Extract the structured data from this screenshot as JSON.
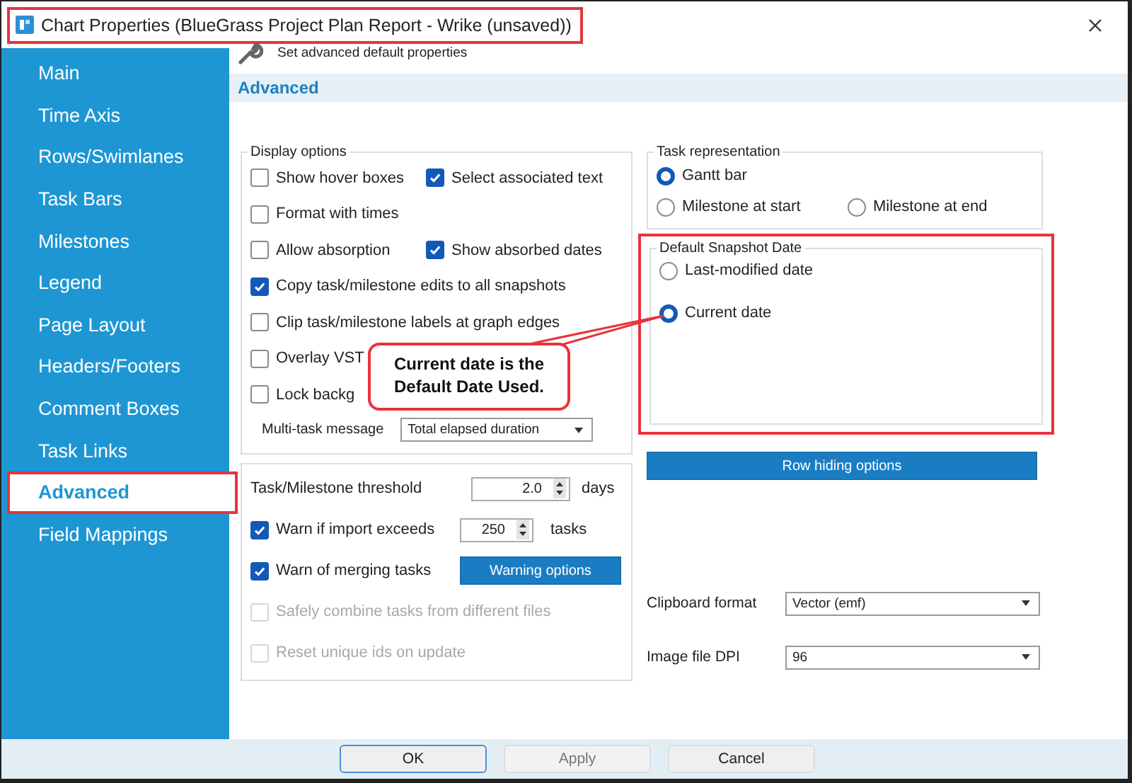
{
  "window": {
    "title": "Chart Properties (BlueGrass Project Plan Report - Wrike (unsaved))",
    "highlighted": true
  },
  "sidebar": {
    "items": [
      {
        "label": "Main",
        "selected": false,
        "highlighted": false
      },
      {
        "label": "Time Axis",
        "selected": false,
        "highlighted": false
      },
      {
        "label": "Rows/Swimlanes",
        "selected": false,
        "highlighted": false
      },
      {
        "label": "Task Bars",
        "selected": false,
        "highlighted": false
      },
      {
        "label": "Milestones",
        "selected": false,
        "highlighted": false
      },
      {
        "label": "Legend",
        "selected": false,
        "highlighted": false
      },
      {
        "label": "Page Layout",
        "selected": false,
        "highlighted": false
      },
      {
        "label": "Headers/Footers",
        "selected": false,
        "highlighted": false
      },
      {
        "label": "Comment Boxes",
        "selected": false,
        "highlighted": false
      },
      {
        "label": "Task Links",
        "selected": false,
        "highlighted": false
      },
      {
        "label": "Advanced",
        "selected": true,
        "highlighted": true
      },
      {
        "label": "Field Mappings",
        "selected": false,
        "highlighted": false
      }
    ]
  },
  "page_header": {
    "description": "Set advanced default properties",
    "section": "Advanced"
  },
  "display_options": {
    "title": "Display options",
    "rows": [
      [
        {
          "label": "Show hover boxes",
          "checked": false
        },
        {
          "label": "Select associated text",
          "checked": true
        }
      ],
      [
        {
          "label": "Format with times",
          "checked": false
        }
      ],
      [
        {
          "label": "Allow absorption",
          "checked": false
        },
        {
          "label": "Show absorbed dates",
          "checked": true
        }
      ],
      [
        {
          "label": "Copy task/milestone edits to all snapshots",
          "checked": true
        }
      ],
      [
        {
          "label": "Clip task/milestone labels at graph edges",
          "checked": false
        }
      ],
      [
        {
          "label": "Overlay VST",
          "checked": false
        }
      ],
      [
        {
          "label": "Lock backg",
          "checked": false
        }
      ]
    ],
    "multi_task": {
      "label": "Multi-task message",
      "value": "Total elapsed duration"
    }
  },
  "thresholds": {
    "items": [
      {
        "kind": "spin",
        "label": "Task/Milestone threshold",
        "value": "2.0",
        "unit": "days"
      },
      {
        "kind": "check-spin",
        "label": "Warn if import exceeds",
        "checked": true,
        "disabled": false,
        "value": "250",
        "unit": "tasks"
      },
      {
        "kind": "check-button",
        "label": "Warn of merging tasks",
        "checked": true,
        "disabled": false,
        "button": "Warning options"
      },
      {
        "kind": "check",
        "label": "Safely combine tasks from different files",
        "checked": false,
        "disabled": true
      },
      {
        "kind": "check",
        "label": "Reset unique ids on update",
        "checked": false,
        "disabled": true
      }
    ]
  },
  "task_representation": {
    "title": "Task representation",
    "rows": [
      [
        {
          "label": "Gantt bar",
          "selected": true
        }
      ],
      [
        {
          "label": "Milestone at start",
          "selected": false
        },
        {
          "label": "Milestone at end",
          "selected": false
        }
      ]
    ]
  },
  "snapshot_date": {
    "title": "Default Snapshot Date",
    "highlighted": true,
    "options": [
      {
        "label": "Last-modified date",
        "selected": false
      },
      {
        "label": "Current date",
        "selected": true
      }
    ]
  },
  "row_hiding_button": "Row hiding options",
  "formats": [
    {
      "label": "Clipboard format",
      "value": "Vector (emf)"
    },
    {
      "label": "Image file DPI",
      "value": "96"
    }
  ],
  "callout": {
    "text": "Current date is the Default Date Used."
  },
  "footer_buttons": [
    {
      "label": "OK",
      "focused": true,
      "disabled": false
    },
    {
      "label": "Apply",
      "focused": false,
      "disabled": true
    },
    {
      "label": "Cancel",
      "focused": false,
      "disabled": false
    }
  ]
}
